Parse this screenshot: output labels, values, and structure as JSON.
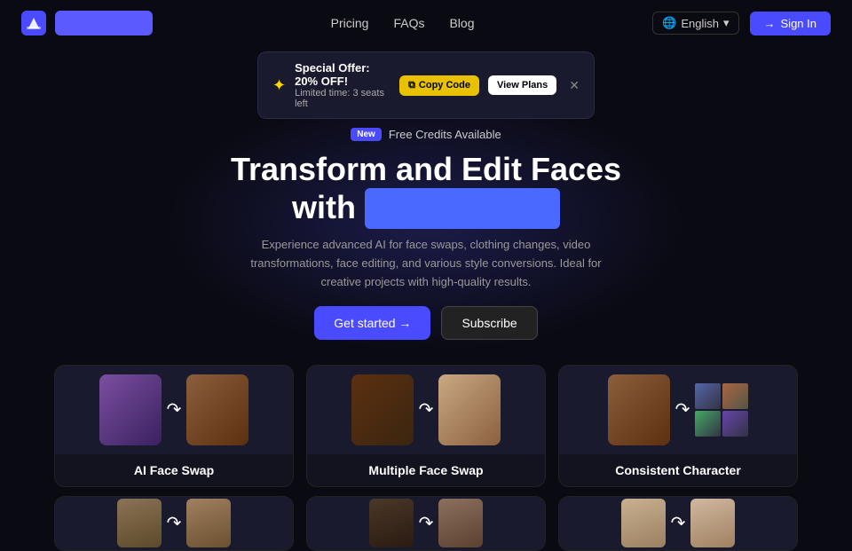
{
  "nav": {
    "logo_alt": "App Logo",
    "links": [
      "Pricing",
      "FAQs",
      "Blog"
    ],
    "lang": "English",
    "signin": "Sign In"
  },
  "banner": {
    "offer_title": "Special Offer: 20% OFF!",
    "offer_subtitle": "Limited time: 3 seats left",
    "copy_label": "Copy Code",
    "view_plans_label": "View Plans"
  },
  "hero": {
    "badge": "New",
    "free_credits": "Free Credits Available",
    "title_line1": "Transform and Edit Faces",
    "title_line2": "with",
    "title_highlight": "",
    "subtitle": "Experience advanced AI for face swaps, clothing changes, video transformations, face editing, and various style conversions. Ideal for creative projects with high-quality results.",
    "get_started": "Get started →",
    "subscribe": "Subscribe"
  },
  "cards_row1": [
    {
      "label": "AI Face Swap"
    },
    {
      "label": "Multiple Face Swap"
    },
    {
      "label": "Consistent Character"
    }
  ],
  "cards_row2": [
    {
      "label": ""
    },
    {
      "label": ""
    },
    {
      "label": ""
    }
  ]
}
